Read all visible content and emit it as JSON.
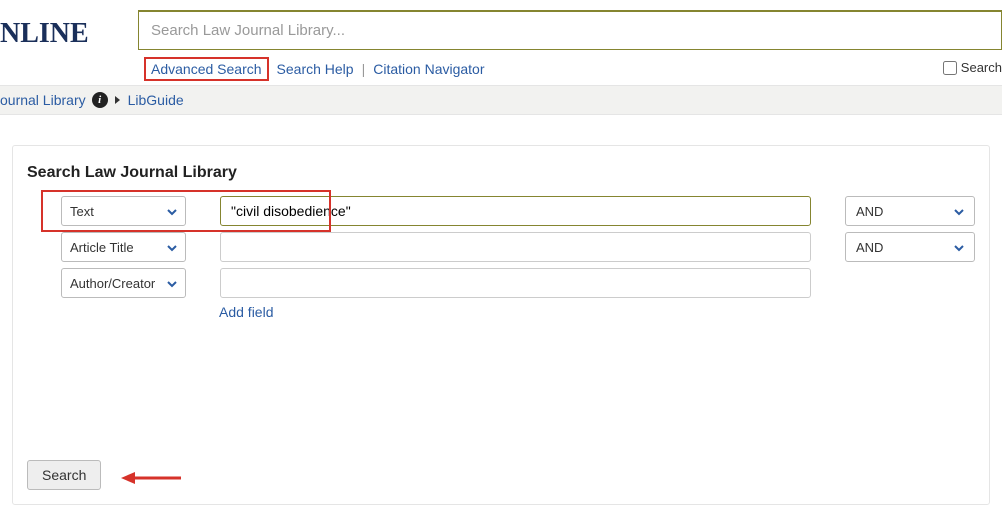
{
  "logo_text": "NLINE",
  "main_search": {
    "placeholder": "Search Law Journal Library..."
  },
  "links": {
    "advanced": "Advanced Search",
    "help": "Search Help",
    "citation": "Citation Navigator"
  },
  "top_checkbox_label": "Search",
  "breadcrumb": {
    "library": "ournal Library",
    "libguide": "LibGuide"
  },
  "form": {
    "title": "Search Law Journal Library",
    "rows": [
      {
        "field": "Text",
        "value": "\"civil disobedience\"",
        "bool": "AND"
      },
      {
        "field": "Article Title",
        "value": "",
        "bool": "AND"
      },
      {
        "field": "Author/Creator",
        "value": "",
        "bool": ""
      }
    ],
    "add_field": "Add field",
    "search_button": "Search"
  }
}
